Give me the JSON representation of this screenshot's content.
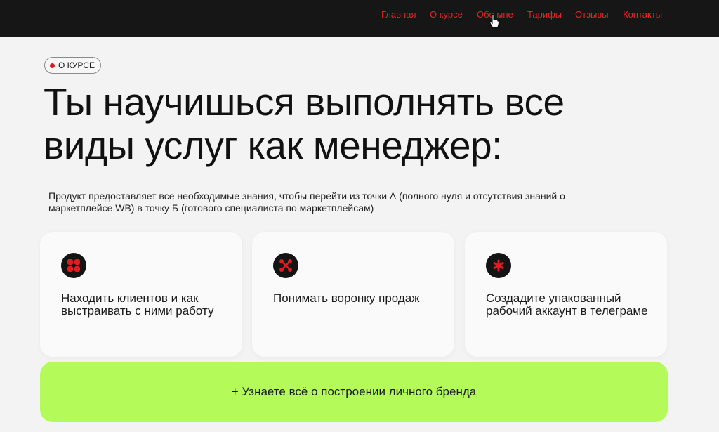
{
  "nav": {
    "items": [
      "Главная",
      "О курсе",
      "Обо мне",
      "Тарифы",
      "Отзывы",
      "Контакты"
    ]
  },
  "badge": {
    "label": "О КУРСЕ",
    "icon": "red-dot-icon"
  },
  "headline": "Ты научишься выполнять все виды услуг как менеджер:",
  "description": "Продукт предоставляет все необходимые знания, чтобы перейти из точки А (полного нуля и отсутствия знаний о маркетплейсе WB) в точку Б (готового специалиста по маркетплейсам)",
  "cards": [
    {
      "icon": "grid-icon",
      "text": "Находить клиентов и как выстраивать с ними работу"
    },
    {
      "icon": "funnel-nodes-icon",
      "text": "Понимать воронку продаж"
    },
    {
      "icon": "asterisk-icon",
      "text": "Создадите упакованный рабочий аккаунт в телеграме"
    }
  ],
  "cta": {
    "label": "+ Узнаете всё о построении личного бренда"
  },
  "colors": {
    "accent": "#e5232b",
    "topbar": "#161616",
    "cta_bg": "#b4fb5a",
    "page_bg": "#f3f3f3"
  }
}
